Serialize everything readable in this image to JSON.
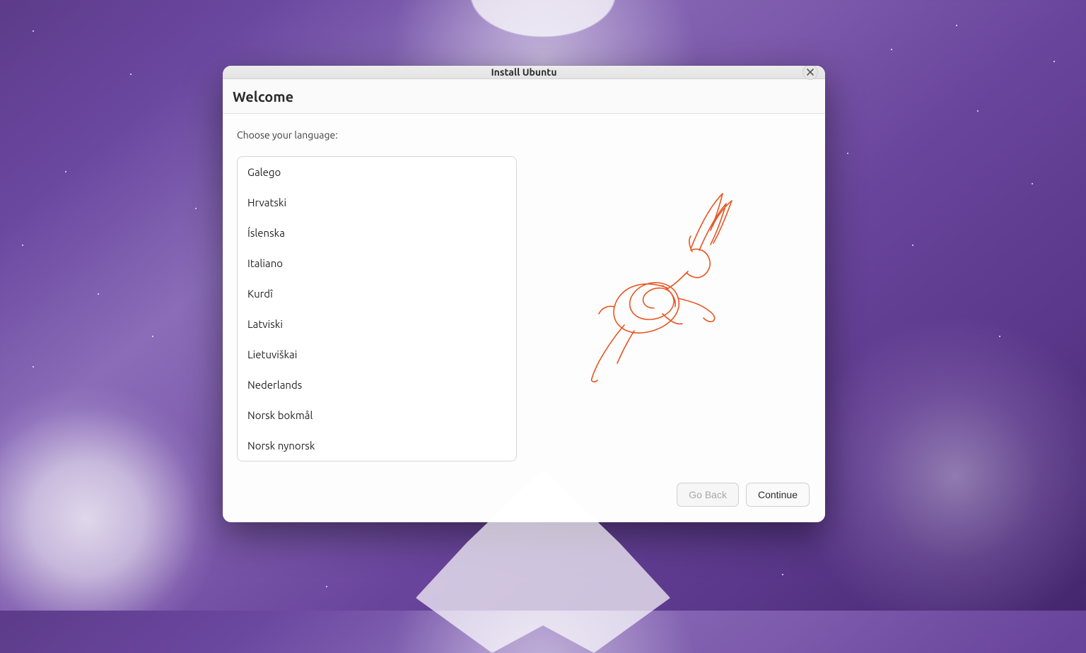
{
  "titlebar": {
    "title": "Install Ubuntu"
  },
  "header": {
    "title": "Welcome"
  },
  "prompt": "Choose your language:",
  "languages": [
    "Galego",
    "Hrvatski",
    "Íslenska",
    "Italiano",
    "Kurdî",
    "Latviski",
    "Lietuviškai",
    "Nederlands",
    "Norsk bokmål",
    "Norsk nynorsk"
  ],
  "buttons": {
    "back": "Go Back",
    "continue": "Continue"
  },
  "colors": {
    "mascot": "#e95420"
  }
}
